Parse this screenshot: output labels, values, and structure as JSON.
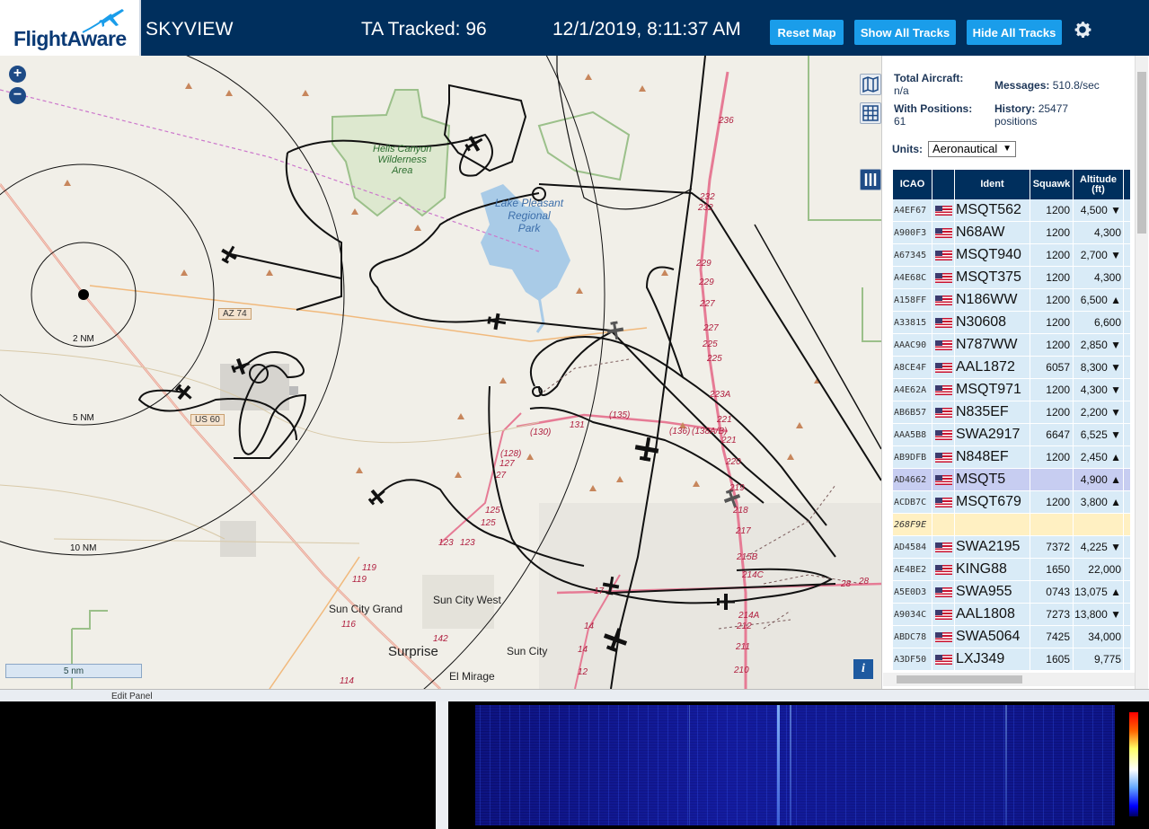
{
  "header": {
    "logo": "FlightAware",
    "title": "SKYVIEW",
    "tracked": "TA Tracked: 96",
    "datetime": "12/1/2019, 8:11:37 AM",
    "buttons": {
      "reset": "Reset Map",
      "show_all": "Show All Tracks",
      "hide_all": "Hide All Tracks"
    },
    "settings_icon": "gear-icon"
  },
  "map": {
    "zoom_in": "+",
    "zoom_out": "−",
    "scale": "5 nm",
    "info": "i",
    "labels": {
      "hells_canyon": [
        "Hells Canyon",
        "Wilderness",
        "Area"
      ],
      "lake_pleasant": [
        "Lake Pleasant",
        "Regional",
        "Park"
      ],
      "sun_city_grand": "Sun City Grand",
      "sun_city_west": "Sun City West",
      "surprise": "Surprise",
      "sun_city": "Sun City",
      "el_mirage": "El Mirage",
      "az74": "AZ 74",
      "us60": "US 60",
      "nm2": "2 NM",
      "nm5": "5 NM",
      "nm10": "10 NM"
    },
    "routes": [
      "236",
      "232",
      "232",
      "229",
      "229",
      "227",
      "227",
      "225",
      "225",
      "223A",
      "221",
      "221",
      "220",
      "219",
      "218",
      "217",
      "215B",
      "214C",
      "214A",
      "212",
      "211",
      "210",
      "(130)",
      "131",
      "(135)",
      "(136)",
      "(138A/B)",
      "(128)",
      "127",
      "27",
      "125",
      "125",
      "123",
      "123",
      "119",
      "119",
      "116",
      "114",
      "142",
      "14",
      "14",
      "12",
      "17",
      "28",
      "28"
    ]
  },
  "panel": {
    "total_aircraft_label": "Total Aircraft:",
    "total_aircraft_value": "n/a",
    "messages_label": "Messages:",
    "messages_value": "510.8/sec",
    "with_positions_label": "With Positions:",
    "with_positions_value": "61",
    "history_label": "History:",
    "history_value": "25477",
    "history_unit": "positions",
    "units_label": "Units:",
    "units_value": "Aeronautical",
    "columns": [
      "ICAO",
      "",
      "Ident",
      "Squawk",
      "Altitude (ft)"
    ],
    "rows": [
      {
        "icao": "A4EF67",
        "ident": "MSQT562",
        "squawk": "1200",
        "alt": "4,500 ▼"
      },
      {
        "icao": "A900F3",
        "ident": "N68AW",
        "squawk": "1200",
        "alt": "4,300"
      },
      {
        "icao": "A67345",
        "ident": "MSQT940",
        "squawk": "1200",
        "alt": "2,700 ▼"
      },
      {
        "icao": "A4E68C",
        "ident": "MSQT375",
        "squawk": "1200",
        "alt": "4,300"
      },
      {
        "icao": "A158FF",
        "ident": "N186WW",
        "squawk": "1200",
        "alt": "6,500 ▲"
      },
      {
        "icao": "A33815",
        "ident": "N30608",
        "squawk": "1200",
        "alt": "6,600"
      },
      {
        "icao": "AAAC90",
        "ident": "N787WW",
        "squawk": "1200",
        "alt": "2,850 ▼"
      },
      {
        "icao": "A8CE4F",
        "ident": "AAL1872",
        "squawk": "6057",
        "alt": "8,300 ▼"
      },
      {
        "icao": "A4E62A",
        "ident": "MSQT971",
        "squawk": "1200",
        "alt": "4,300 ▼"
      },
      {
        "icao": "AB6B57",
        "ident": "N835EF",
        "squawk": "1200",
        "alt": "2,200 ▼"
      },
      {
        "icao": "AAA5B8",
        "ident": "SWA2917",
        "squawk": "6647",
        "alt": "6,525 ▼"
      },
      {
        "icao": "AB9DFB",
        "ident": "N848EF",
        "squawk": "1200",
        "alt": "2,450 ▲"
      },
      {
        "icao": "AD4662",
        "ident": "MSQT5",
        "squawk": "",
        "alt": "4,900 ▲",
        "selected": true
      },
      {
        "icao": "ACDB7C",
        "ident": "MSQT679",
        "squawk": "1200",
        "alt": "3,800 ▲"
      },
      {
        "icao": "268F9E",
        "ident": "",
        "squawk": "",
        "alt": "",
        "noflag": true,
        "yellow": true
      },
      {
        "icao": "AD4584",
        "ident": "SWA2195",
        "squawk": "7372",
        "alt": "4,225 ▼"
      },
      {
        "icao": "AE4BE2",
        "ident": "KING88",
        "squawk": "1650",
        "alt": "22,000"
      },
      {
        "icao": "A5E0D3",
        "ident": "SWA955",
        "squawk": "0743",
        "alt": "13,075 ▲"
      },
      {
        "icao": "A9034C",
        "ident": "AAL1808",
        "squawk": "7273",
        "alt": "13,800 ▼"
      },
      {
        "icao": "ABDC78",
        "ident": "SWA5064",
        "squawk": "7425",
        "alt": "34,000"
      },
      {
        "icao": "A3DF50",
        "ident": "LXJ349",
        "squawk": "1605",
        "alt": "9,775"
      }
    ]
  },
  "strip": {
    "label": "Edit Panel"
  },
  "colors": {
    "header_bg": "#002f5d",
    "button_bg": "#1a9dea",
    "row_bg": "#d9ebf7",
    "row_selected": "#c7cdf1",
    "row_yellow": "#fff0c2"
  }
}
